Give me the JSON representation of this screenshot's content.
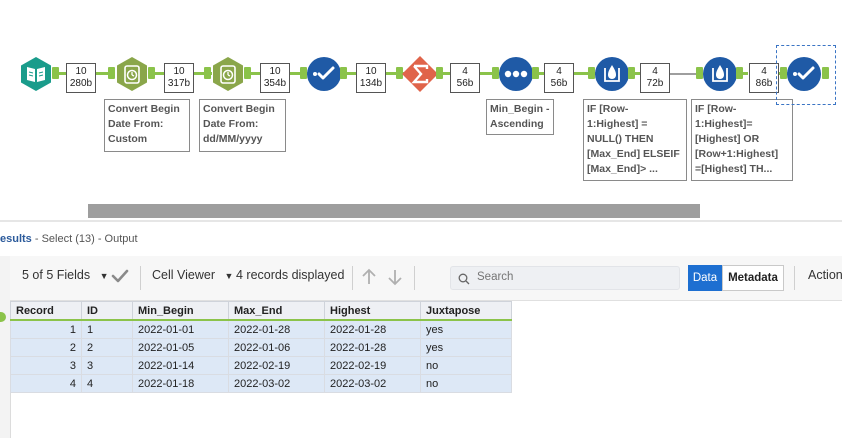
{
  "workflow": {
    "counts": [
      {
        "records": "10",
        "size": "280b"
      },
      {
        "records": "10",
        "size": "317b"
      },
      {
        "records": "10",
        "size": "354b"
      },
      {
        "records": "10",
        "size": "134b"
      },
      {
        "records": "4",
        "size": "56b"
      },
      {
        "records": "4",
        "size": "56b"
      },
      {
        "records": "4",
        "size": "72b"
      },
      {
        "records": "4",
        "size": "86b"
      }
    ],
    "annotations": {
      "datetime1": "Convert Begin\nDate From:\nCustom",
      "datetime2": "Convert Begin\nDate From:\ndd/MM/yyyy",
      "sort": "Min_Begin -\nAscending",
      "formula1": "IF [Row-\n1:Highest] =\nNULL() THEN\n[Max_End] ELSEIF\n[Max_End]> ...",
      "formula2": "IF [Row-\n1:Highest]=\n[Highest] OR\n[Row+1:Highest]\n=[Highest]  TH..."
    },
    "icons": [
      "input-book-icon",
      "datetime-icon",
      "datetime-icon",
      "select-check-icon",
      "summarize-sigma-icon",
      "sort-dots-icon",
      "multirow-formula-icon",
      "multirow-formula-icon",
      "select-check-icon"
    ],
    "colors": {
      "connector": "#8bc34a",
      "blue_tool": "#1f5aa6",
      "teal_tool": "#1a9c8b",
      "green_tool": "#8aa64a",
      "orange_tool": "#e0644a"
    }
  },
  "results": {
    "title": "esults",
    "subtitle": " - Select (13) - Output"
  },
  "toolbar": {
    "fields": "5 of 5 Fields",
    "cell_viewer": "Cell Viewer",
    "records_displayed": "4 records displayed",
    "search_placeholder": "Search",
    "data_tab": "Data",
    "metadata_tab": "Metadata",
    "actions": "Action"
  },
  "table": {
    "columns": [
      "Record",
      "ID",
      "Min_Begin",
      "Max_End",
      "Highest",
      "Juxtapose"
    ],
    "rows": [
      [
        "1",
        "1",
        "2022-01-01",
        "2022-01-28",
        "2022-01-28",
        "yes"
      ],
      [
        "2",
        "2",
        "2022-01-05",
        "2022-01-06",
        "2022-01-28",
        "yes"
      ],
      [
        "3",
        "3",
        "2022-01-14",
        "2022-02-19",
        "2022-02-19",
        "no"
      ],
      [
        "4",
        "4",
        "2022-01-18",
        "2022-03-02",
        "2022-03-02",
        "no"
      ]
    ]
  }
}
